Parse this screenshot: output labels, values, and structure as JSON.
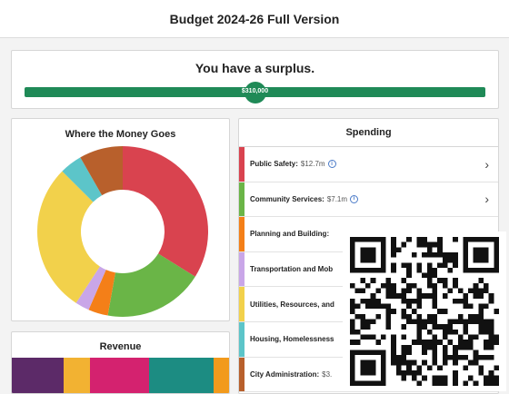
{
  "header": {
    "title": "Budget 2024-26 Full Version"
  },
  "surplus": {
    "title": "You have a surplus.",
    "amount": "$310,000",
    "bar_color": "#1f8a57"
  },
  "money": {
    "title": "Where the Money Goes",
    "slices": [
      {
        "name": "Public Safety",
        "value": 12.7,
        "color": "#d9434f"
      },
      {
        "name": "Community Services",
        "value": 7.1,
        "color": "#6ab547"
      },
      {
        "name": "Planning and Building",
        "value": 1.4,
        "color": "#f47f18"
      },
      {
        "name": "Transportation and Mobility",
        "value": 1.0,
        "color": "#c9a6e8"
      },
      {
        "name": "Utilities, Resources, and Environment",
        "value": 10.6,
        "color": "#f2d14b"
      },
      {
        "name": "Housing, Homelessness",
        "value": 1.6,
        "color": "#5cc5c9"
      },
      {
        "name": "City Administration",
        "value": 3.1,
        "color": "#b8602c"
      }
    ]
  },
  "revenue": {
    "title": "Revenue",
    "segments": [
      {
        "share": 24,
        "color": "#5c2a68"
      },
      {
        "share": 12,
        "color": "#f2b232"
      },
      {
        "share": 27,
        "color": "#d4226f"
      },
      {
        "share": 30,
        "color": "#1c8c82"
      },
      {
        "share": 7,
        "color": "#f29a1c"
      }
    ]
  },
  "spending": {
    "title": "Spending",
    "items": [
      {
        "label": "Public Safety:",
        "amount": "$12.7m",
        "info": true,
        "color": "#d9434f"
      },
      {
        "label": "Community Services:",
        "amount": "$7.1m",
        "info": true,
        "color": "#6ab547"
      },
      {
        "label": "Planning and Building:",
        "amount": "",
        "info": false,
        "color": "#f47f18"
      },
      {
        "label": "Transportation and Mob",
        "amount": "",
        "info": false,
        "color": "#c9a6e8"
      },
      {
        "label": "Utilities, Resources, and",
        "amount": "",
        "info": false,
        "color": "#f2d14b"
      },
      {
        "label": "Housing, Homelessness",
        "amount": "",
        "info": false,
        "color": "#5cc5c9"
      },
      {
        "label": "City Administration:",
        "amount": "$3.",
        "info": false,
        "color": "#b8602c"
      }
    ]
  },
  "icons": {
    "info": "info-icon",
    "chevron": "chevron-right-icon",
    "qr": "qr-code"
  }
}
